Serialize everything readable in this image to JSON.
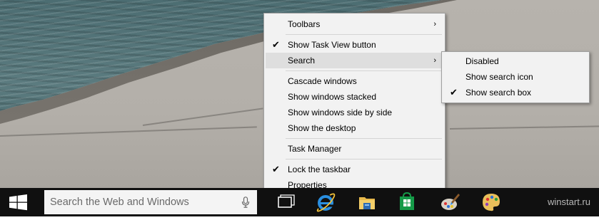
{
  "context_menu": {
    "items": [
      {
        "label": "Toolbars",
        "checked": false,
        "has_submenu": true
      },
      {
        "label": "Show Task View button",
        "checked": true,
        "has_submenu": false
      },
      {
        "label": "Search",
        "checked": false,
        "has_submenu": true,
        "highlighted": true
      },
      {
        "label": "Cascade windows",
        "checked": false,
        "has_submenu": false
      },
      {
        "label": "Show windows stacked",
        "checked": false,
        "has_submenu": false
      },
      {
        "label": "Show windows side by side",
        "checked": false,
        "has_submenu": false
      },
      {
        "label": "Show the desktop",
        "checked": false,
        "has_submenu": false
      },
      {
        "label": "Task Manager",
        "checked": false,
        "has_submenu": false
      },
      {
        "label": "Lock the taskbar",
        "checked": true,
        "has_submenu": false
      },
      {
        "label": "Properties",
        "checked": false,
        "has_submenu": false
      }
    ],
    "check_glyph": "✔",
    "arrow_glyph": "›"
  },
  "search_submenu": {
    "items": [
      {
        "label": "Disabled",
        "checked": false
      },
      {
        "label": "Show search icon",
        "checked": false
      },
      {
        "label": "Show search box",
        "checked": true
      }
    ]
  },
  "taskbar": {
    "search_placeholder": "Search the Web and Windows",
    "icons": [
      "windows-logo-icon",
      "microphone-icon",
      "task-view-icon",
      "internet-explorer-icon",
      "file-explorer-icon",
      "store-icon",
      "paint-icon",
      "palette-icon"
    ],
    "watermark": "winstart.ru"
  },
  "colors": {
    "taskbar": "#101010",
    "menu_bg": "#f2f2f2",
    "menu_highlight": "#dedede",
    "windows_blue": "#1e90ff"
  }
}
